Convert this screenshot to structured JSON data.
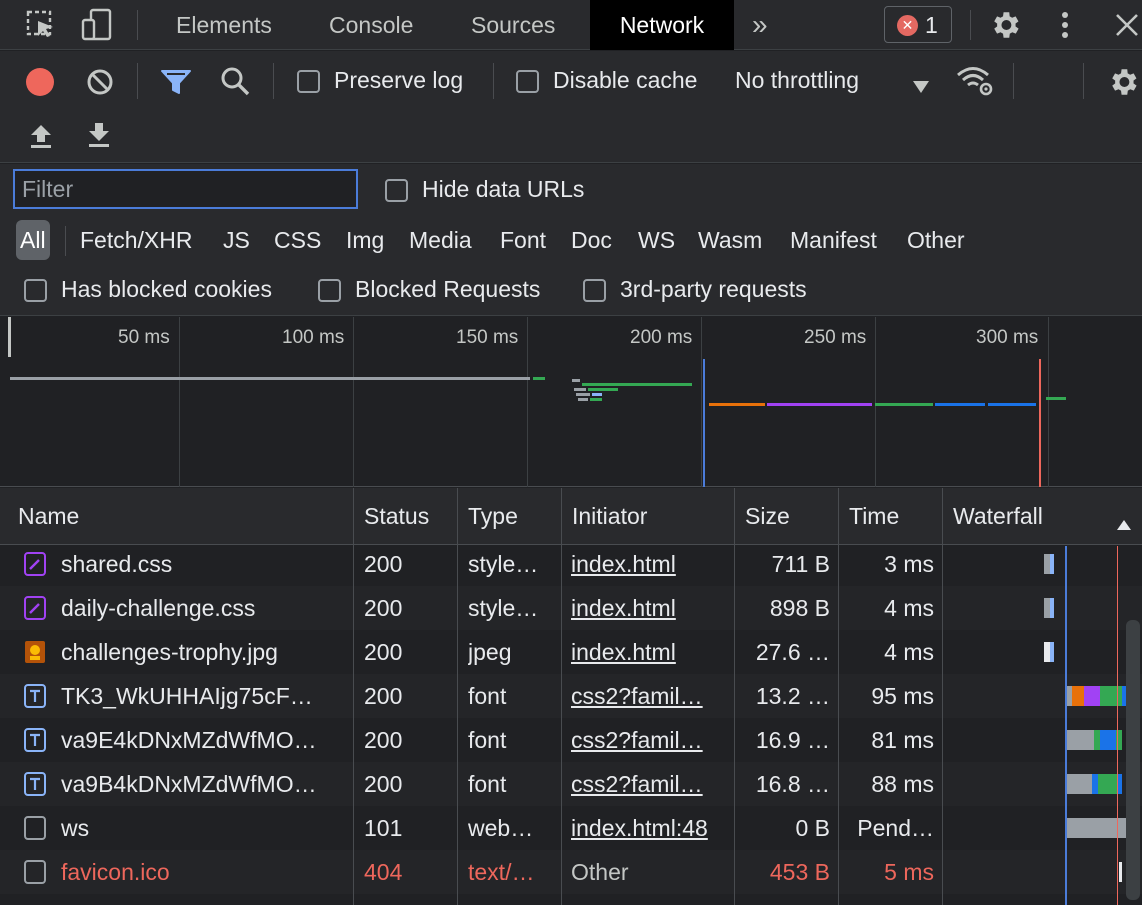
{
  "tabs": {
    "elements": "Elements",
    "console": "Console",
    "sources": "Sources",
    "network": "Network",
    "more": "»",
    "error_count": "1"
  },
  "toolbar": {
    "preserve_log": "Preserve log",
    "disable_cache": "Disable cache",
    "throttling": "No throttling"
  },
  "filter": {
    "placeholder": "Filter",
    "hide_data_urls": "Hide data URLs",
    "types": [
      "All",
      "Fetch/XHR",
      "JS",
      "CSS",
      "Img",
      "Media",
      "Font",
      "Doc",
      "WS",
      "Wasm",
      "Manifest",
      "Other"
    ],
    "active_type": "All",
    "has_blocked_cookies": "Has blocked cookies",
    "blocked_requests": "Blocked Requests",
    "third_party": "3rd-party requests"
  },
  "overview": {
    "ticks": [
      "50 ms",
      "100 ms",
      "150 ms",
      "200 ms",
      "250 ms",
      "300 ms"
    ]
  },
  "table": {
    "headers": {
      "name": "Name",
      "status": "Status",
      "type": "Type",
      "initiator": "Initiator",
      "size": "Size",
      "time": "Time",
      "waterfall": "Waterfall"
    },
    "rows": [
      {
        "name": "shared.css",
        "status": "200",
        "type": "style…",
        "initiator": "index.html",
        "size": "711 B",
        "time": "3 ms",
        "icon": "css-file-icon",
        "icon_color": "#a142f4"
      },
      {
        "name": "daily-challenge.css",
        "status": "200",
        "type": "style…",
        "initiator": "index.html",
        "size": "898 B",
        "time": "4 ms",
        "icon": "css-file-icon",
        "icon_color": "#a142f4"
      },
      {
        "name": "challenges-trophy.jpg",
        "status": "200",
        "type": "jpeg",
        "initiator": "index.html",
        "size": "27.6 …",
        "time": "4 ms",
        "icon": "image-file-icon",
        "icon_color": "#e8710a"
      },
      {
        "name": "TK3_WkUHHAIjg75cF…",
        "status": "200",
        "type": "font",
        "initiator": "css2?famil…",
        "size": "13.2 …",
        "time": "95 ms",
        "icon": "font-file-icon",
        "icon_color": "#1a73e8"
      },
      {
        "name": "va9E4kDNxMZdWfMO…",
        "status": "200",
        "type": "font",
        "initiator": "css2?famil…",
        "size": "16.9 …",
        "time": "81 ms",
        "icon": "font-file-icon",
        "icon_color": "#1a73e8"
      },
      {
        "name": "va9B4kDNxMZdWfMO…",
        "status": "200",
        "type": "font",
        "initiator": "css2?famil…",
        "size": "16.8 …",
        "time": "88 ms",
        "icon": "font-file-icon",
        "icon_color": "#1a73e8"
      },
      {
        "name": "ws",
        "status": "101",
        "type": "web…",
        "initiator": "index.html:48",
        "size": "0 B",
        "time": "Pend…",
        "icon": "document-icon",
        "icon_color": "#9aa0a6"
      },
      {
        "name": "favicon.ico",
        "status": "404",
        "type": "text/…",
        "initiator": "Other",
        "size": "453 B",
        "time": "5 ms",
        "icon": "document-icon",
        "icon_color": "#9aa0a6",
        "error": true
      }
    ]
  },
  "colors": {
    "record": "#ee675c",
    "filter_active": "#8ab4f8",
    "error": "#ee675c"
  }
}
